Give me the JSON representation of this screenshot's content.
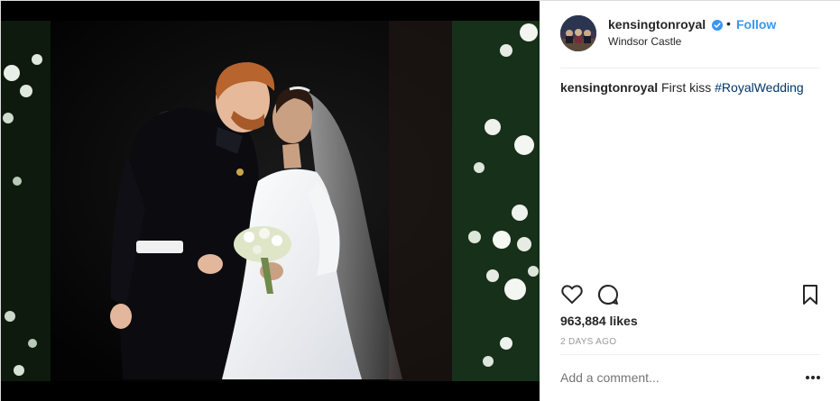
{
  "post": {
    "username": "kensingtonroyal",
    "follow_label": "Follow",
    "separator": "•",
    "location": "Windsor Castle",
    "caption": {
      "username": "kensingtonroyal",
      "text": "First kiss",
      "hashtag": "#RoyalWedding"
    },
    "likes": "963,884 likes",
    "time": "2 DAYS AGO",
    "comment_placeholder": "Add a comment..."
  },
  "colors": {
    "link": "#3897f0",
    "hashtag": "#003569",
    "verified": "#3897f0",
    "muted": "#999999"
  },
  "icons": {
    "like": "heart-icon",
    "comment": "comment-icon",
    "save": "bookmark-icon",
    "more": "more-options-icon",
    "verified": "verified-badge-icon"
  }
}
